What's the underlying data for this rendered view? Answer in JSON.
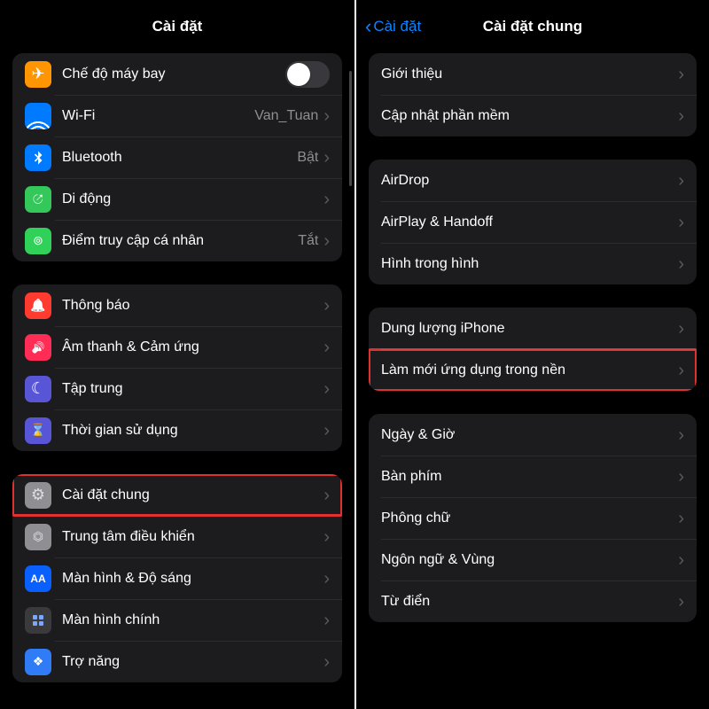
{
  "left": {
    "title": "Cài đặt",
    "groups": [
      {
        "rows": [
          {
            "name": "airplane-mode",
            "icon": "airplane-icon",
            "iconClass": "bg-orange glyph-plane",
            "label": "Chế độ máy bay",
            "control": "toggle",
            "toggleOn": false
          },
          {
            "name": "wifi",
            "icon": "wifi-icon",
            "iconClass": "glyph-wifi",
            "label": "Wi-Fi",
            "value": "Van_Tuan",
            "chevron": true
          },
          {
            "name": "bluetooth",
            "icon": "bluetooth-icon",
            "iconClass": "bg-blue",
            "svg": "bt",
            "label": "Bluetooth",
            "value": "Bật",
            "chevron": true
          },
          {
            "name": "cellular",
            "icon": "antenna-icon",
            "iconClass": "bg-green glyph-antenna",
            "label": "Di động",
            "chevron": true
          },
          {
            "name": "hotspot",
            "icon": "hotspot-icon",
            "iconClass": "bg-green2 glyph-link",
            "label": "Điểm truy cập cá nhân",
            "value": "Tắt",
            "chevron": true
          }
        ]
      },
      {
        "rows": [
          {
            "name": "notifications",
            "icon": "bell-icon",
            "iconClass": "bg-red glyph-bell",
            "label": "Thông báo",
            "chevron": true
          },
          {
            "name": "sounds",
            "icon": "sound-icon",
            "iconClass": "bg-pink glyph-sound",
            "label": "Âm thanh & Cảm ứng",
            "chevron": true
          },
          {
            "name": "focus",
            "icon": "moon-icon",
            "iconClass": "bg-indigo glyph-moon",
            "label": "Tập trung",
            "chevron": true
          },
          {
            "name": "screen-time",
            "icon": "hourglass-icon",
            "iconClass": "bg-indigo glyph-hour",
            "label": "Thời gian sử dụng",
            "chevron": true
          }
        ]
      },
      {
        "rows": [
          {
            "name": "general",
            "icon": "gear-icon",
            "iconClass": "bg-gray glyph-gear",
            "label": "Cài đặt chung",
            "chevron": true,
            "highlight": true
          },
          {
            "name": "control-center",
            "icon": "sliders-icon",
            "iconClass": "bg-gray glyph-sliders",
            "label": "Trung tâm điều khiển",
            "chevron": true
          },
          {
            "name": "display",
            "icon": "aa-icon",
            "iconClass": "bg-blue2 glyph-aa",
            "label": "Màn hình & Độ sáng",
            "chevron": true
          },
          {
            "name": "home-screen",
            "icon": "grid-icon",
            "iconClass": "bg-grid",
            "grid": true,
            "label": "Màn hình chính",
            "chevron": true
          },
          {
            "name": "accessibility",
            "icon": "accessibility-icon",
            "iconClass": "bg-blue3 glyph-access",
            "label": "Trợ năng",
            "chevron": true
          }
        ]
      }
    ]
  },
  "right": {
    "back": "Cài đặt",
    "title": "Cài đặt chung",
    "groups": [
      {
        "rows": [
          {
            "name": "about",
            "label": "Giới thiệu",
            "chevron": true
          },
          {
            "name": "software-update",
            "label": "Cập nhật phần mềm",
            "chevron": true
          }
        ]
      },
      {
        "rows": [
          {
            "name": "airdrop",
            "label": "AirDrop",
            "chevron": true
          },
          {
            "name": "airplay-handoff",
            "label": "AirPlay & Handoff",
            "chevron": true
          },
          {
            "name": "pip",
            "label": "Hình trong hình",
            "chevron": true
          }
        ]
      },
      {
        "rows": [
          {
            "name": "iphone-storage",
            "label": "Dung lượng iPhone",
            "chevron": true
          },
          {
            "name": "background-app-refresh",
            "label": "Làm mới ứng dụng trong nền",
            "chevron": true,
            "highlight": true
          }
        ]
      },
      {
        "rows": [
          {
            "name": "date-time",
            "label": "Ngày & Giờ",
            "chevron": true
          },
          {
            "name": "keyboard",
            "label": "Bàn phím",
            "chevron": true
          },
          {
            "name": "fonts",
            "label": "Phông chữ",
            "chevron": true
          },
          {
            "name": "language-region",
            "label": "Ngôn ngữ & Vùng",
            "chevron": true
          },
          {
            "name": "dictionary",
            "label": "Từ điển",
            "chevron": true
          }
        ]
      }
    ]
  }
}
